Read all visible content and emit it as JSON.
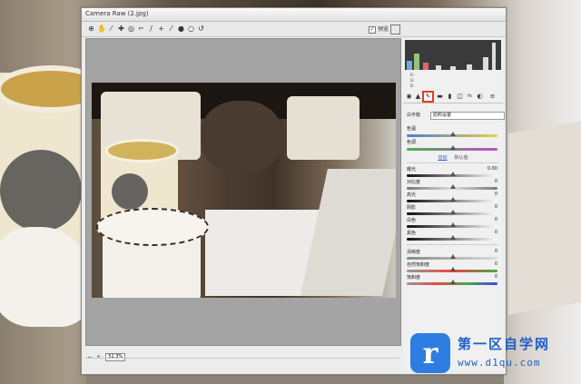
{
  "window": {
    "title": "Camera Raw (2.jpg)"
  },
  "toolbar": {
    "tools": [
      {
        "icon": "zoom-icon",
        "glyph": "⊕"
      },
      {
        "icon": "hand-icon",
        "glyph": "✋"
      },
      {
        "icon": "white-balance-icon",
        "glyph": "⁄"
      },
      {
        "icon": "color-sampler-icon",
        "glyph": "✚"
      },
      {
        "icon": "target-adjust-icon",
        "glyph": "◎"
      },
      {
        "icon": "crop-icon",
        "glyph": "⌐"
      },
      {
        "icon": "straighten-icon",
        "glyph": "/"
      },
      {
        "icon": "redeye-icon",
        "glyph": "+"
      },
      {
        "icon": "spot-removal-icon",
        "glyph": "⁄"
      },
      {
        "icon": "adjust-brush-icon",
        "glyph": "●"
      },
      {
        "icon": "graduated-filter-icon",
        "glyph": "○"
      },
      {
        "icon": "rotate-icon",
        "glyph": "↺"
      }
    ],
    "preview_label": "预览",
    "preview_checked": "✓"
  },
  "zoom": {
    "minus": "−",
    "plus": "+",
    "value": "52.3%"
  },
  "panel": {
    "readout": {
      "r": "R:",
      "g": "G:",
      "b": "B:"
    },
    "tabs": [
      {
        "icon": "basic-tab-icon",
        "glyph": "◉"
      },
      {
        "icon": "tone-curve-tab-icon",
        "glyph": "▲"
      },
      {
        "icon": "detail-tab-icon",
        "glyph": "✎"
      },
      {
        "icon": "hsl-tab-icon",
        "glyph": "▬"
      },
      {
        "icon": "split-tone-tab-icon",
        "glyph": "▮"
      },
      {
        "icon": "lens-tab-icon",
        "glyph": "◫"
      },
      {
        "icon": "fx-tab-icon",
        "glyph": "fx"
      },
      {
        "icon": "camera-cal-tab-icon",
        "glyph": "◐"
      },
      {
        "icon": "presets-tab-icon",
        "glyph": "≡"
      }
    ],
    "wb_label": "白平衡",
    "wb_value": "原照设置",
    "temp_label": "色温",
    "tint_label": "色调",
    "auto_link": "自动",
    "default_link": "默认值",
    "sliders": [
      {
        "label": "曝光",
        "value": "0.00"
      },
      {
        "label": "对比度",
        "value": "0"
      },
      {
        "label": "高光",
        "value": "0"
      },
      {
        "label": "阴影",
        "value": "0"
      },
      {
        "label": "白色",
        "value": "0"
      },
      {
        "label": "黑色",
        "value": "0"
      }
    ],
    "sliders2": [
      {
        "label": "清晰度",
        "value": "0"
      },
      {
        "label": "自然饱和度",
        "value": "0"
      },
      {
        "label": "饱和度",
        "value": "0"
      }
    ]
  },
  "watermark": {
    "glyph": "r",
    "name": "第一区自学网",
    "url": "www.d1qu.com"
  },
  "colors": {
    "accent": "#2e7de2",
    "tab_highlight": "#e23a2b",
    "link": "#2b64c8"
  }
}
